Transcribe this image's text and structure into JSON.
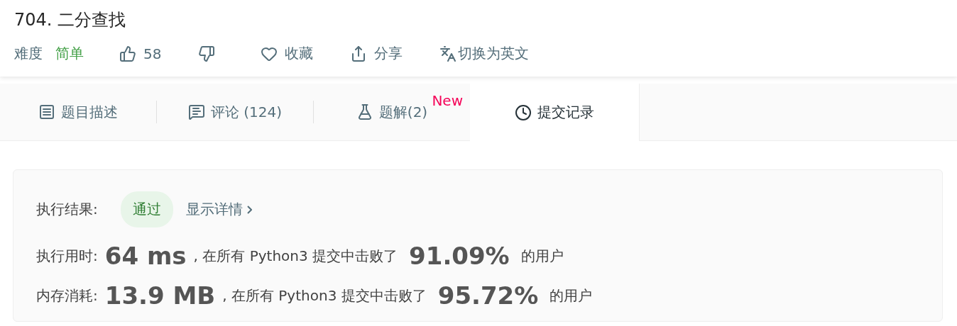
{
  "title": "704. 二分查找",
  "meta": {
    "difficulty_label": "难度",
    "difficulty": "简单",
    "likes": "58",
    "actions": [
      {
        "kind": "favorite",
        "label": "收藏"
      },
      {
        "kind": "share",
        "label": "分享"
      },
      {
        "kind": "translate",
        "label": "切换为英文"
      }
    ]
  },
  "tabs": [
    {
      "kind": "description",
      "label": "题目描述",
      "selected": false
    },
    {
      "kind": "comments",
      "label": "评论 (124)",
      "selected": false
    },
    {
      "kind": "solutions",
      "label": "题解(2)",
      "badge": "New",
      "selected": false
    },
    {
      "kind": "submissions",
      "label": "提交记录",
      "selected": true
    }
  ],
  "result": {
    "label": "执行结果:",
    "status": "通过",
    "details_link": "显示详情",
    "stats": [
      {
        "label": "执行用时:",
        "value": "64 ms",
        "text": ", 在所有 Python3 提交中击败了",
        "percent": "91.09%",
        "suffix": "的用户"
      },
      {
        "label": "内存消耗:",
        "value": "13.9 MB",
        "text": ", 在所有 Python3 提交中击败了",
        "percent": "95.72%",
        "suffix": "的用户"
      }
    ]
  }
}
